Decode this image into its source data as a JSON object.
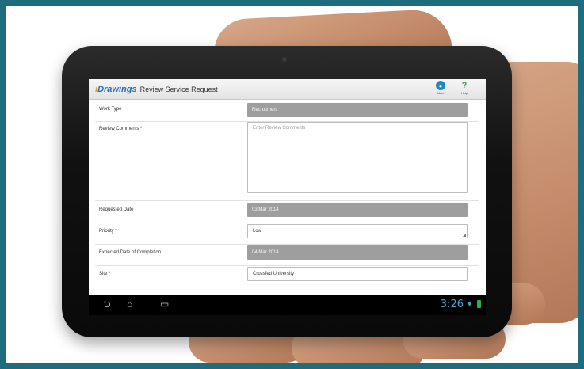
{
  "app": {
    "logo_prefix": "i",
    "logo_text": "Drawings",
    "title": "Review Service Request"
  },
  "header_buttons": {
    "more_label": "More",
    "help_label": "Help"
  },
  "form": {
    "work_type": {
      "label": "Work Type",
      "value": "Recruitment"
    },
    "review_comments": {
      "label": "Review Comments *",
      "placeholder": "Enter Review Comments"
    },
    "requested_date": {
      "label": "Requested Date",
      "value": "03 Mar 2014"
    },
    "priority": {
      "label": "Priority *",
      "value": "Low"
    },
    "expected_date": {
      "label": "Expected Date of Completion",
      "value": "04 Mar 2014"
    },
    "site": {
      "label": "Site *",
      "value": "Crossfed University"
    }
  },
  "status_bar": {
    "time": "3:26",
    "icons": [
      "back-icon",
      "home-icon",
      "recent-apps-icon",
      "wifi-icon",
      "battery-icon"
    ]
  },
  "colors": {
    "border": "#1d6d7e",
    "brand_blue": "#1f6fb6",
    "readonly_field": "#9e9e9e",
    "clock_blue": "#4aa3c6"
  }
}
